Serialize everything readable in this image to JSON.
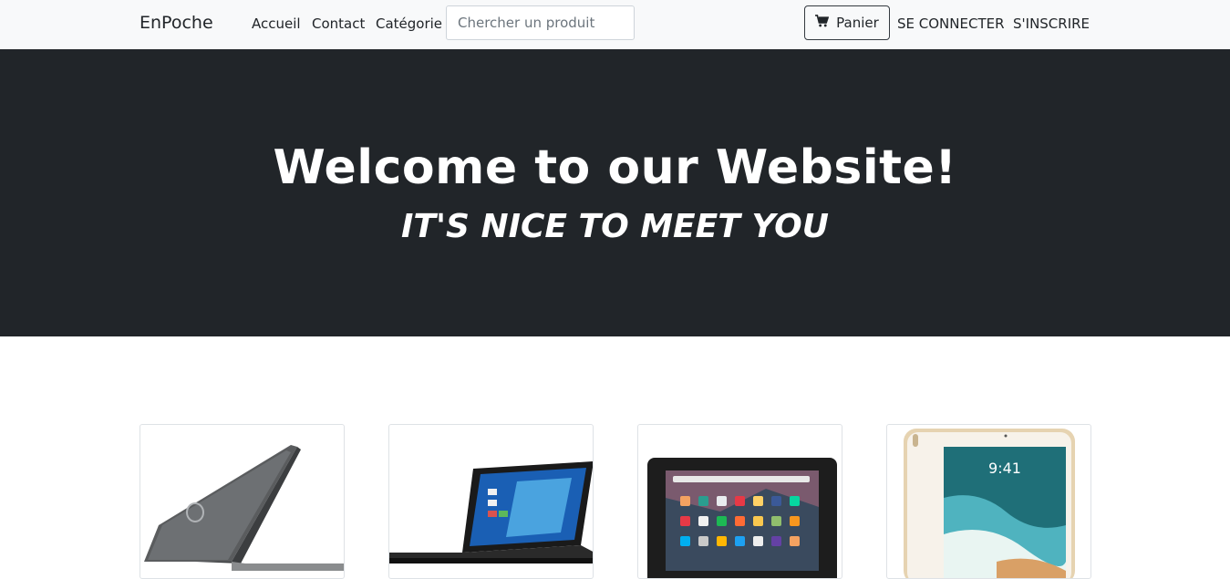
{
  "navbar": {
    "brand": "EnPoche",
    "links": [
      "Accueil",
      "Contact",
      "Catégorie"
    ],
    "search_placeholder": "Chercher un produit",
    "cart_label": "Panier",
    "cart_icon": "cart-icon",
    "login": "SE CONNECTER",
    "register": "S'INSCRIRE"
  },
  "hero": {
    "title": "Welcome to our Website!",
    "subtitle": "IT'S NICE TO MEET YOU"
  },
  "products": [
    {
      "image": "laptop-back-image"
    },
    {
      "image": "laptop-front-image"
    },
    {
      "image": "tablet-landscape-image"
    },
    {
      "image": "tablet-portrait-image"
    }
  ],
  "tablet_clock": "9:41",
  "colors": {
    "navbar_bg": "#f8f9fa",
    "hero_bg": "#212529",
    "text": "#212529"
  }
}
